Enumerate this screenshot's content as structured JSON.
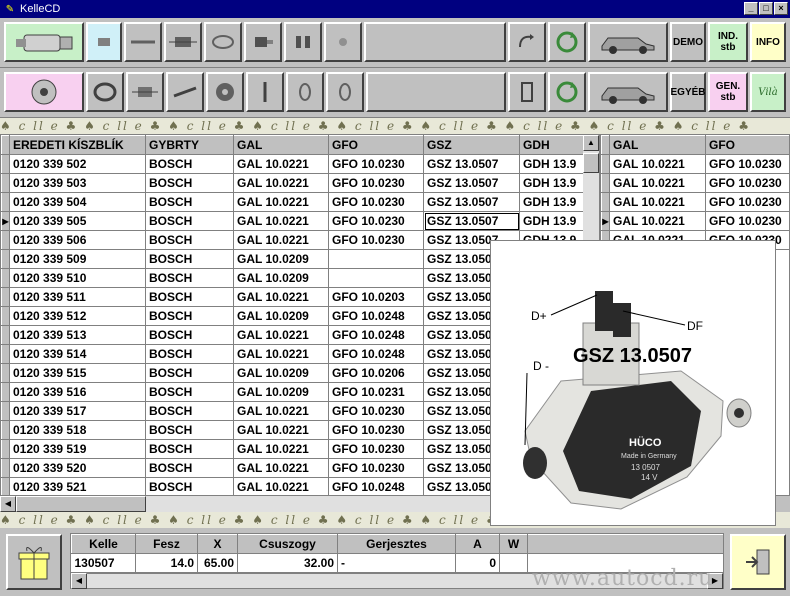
{
  "window": {
    "title": "KelleCD",
    "min": "_",
    "max": "□",
    "close": "×"
  },
  "toolbar1": {
    "demo": "DEMO",
    "ind": "IND.\nstb",
    "info": "INFO"
  },
  "toolbar2": {
    "egyeb": "EGYÉB",
    "gen": "GEN.\nstb",
    "brand": "Vilà"
  },
  "strip_text": "♠ c ll e ♣ ♠ c ll e ♣ ♠ c ll e ♣ ♠ c ll e ♣ ♠ c ll e ♣ ♠ c ll e ♣ ♠ c ll e ♣ ♠ c ll e ♣ ♠ c ll e ♣",
  "main_table": {
    "columns": [
      "EREDETI KÍSZBLÍK",
      "GYBRTY",
      "GAL",
      "GFO",
      "GSZ",
      "GDH"
    ],
    "rows": [
      [
        "0120 339 502",
        "BOSCH",
        "GAL 10.0221",
        "GFO 10.0230",
        "GSZ 13.0507",
        "GDH 13.9"
      ],
      [
        "0120 339 503",
        "BOSCH",
        "GAL 10.0221",
        "GFO 10.0230",
        "GSZ 13.0507",
        "GDH 13.9"
      ],
      [
        "0120 339 504",
        "BOSCH",
        "GAL 10.0221",
        "GFO 10.0230",
        "GSZ 13.0507",
        "GDH 13.9"
      ],
      [
        "0120 339 505",
        "BOSCH",
        "GAL 10.0221",
        "GFO 10.0230",
        "GSZ 13.0507",
        "GDH 13.9"
      ],
      [
        "0120 339 506",
        "BOSCH",
        "GAL 10.0221",
        "GFO 10.0230",
        "GSZ 13.0507",
        "GDH 13.9"
      ],
      [
        "0120 339 509",
        "BOSCH",
        "GAL 10.0209",
        "",
        "GSZ 13.050",
        ""
      ],
      [
        "0120 339 510",
        "BOSCH",
        "GAL 10.0209",
        "",
        "GSZ 13.050",
        ""
      ],
      [
        "0120 339 511",
        "BOSCH",
        "GAL 10.0221",
        "GFO 10.0203",
        "GSZ 13.050",
        ""
      ],
      [
        "0120 339 512",
        "BOSCH",
        "GAL 10.0209",
        "GFO 10.0248",
        "GSZ 13.050",
        ""
      ],
      [
        "0120 339 513",
        "BOSCH",
        "GAL 10.0221",
        "GFO 10.0248",
        "GSZ 13.050",
        ""
      ],
      [
        "0120 339 514",
        "BOSCH",
        "GAL 10.0221",
        "GFO 10.0248",
        "GSZ 13.050",
        ""
      ],
      [
        "0120 339 515",
        "BOSCH",
        "GAL 10.0209",
        "GFO 10.0206",
        "GSZ 13.050",
        ""
      ],
      [
        "0120 339 516",
        "BOSCH",
        "GAL 10.0209",
        "GFO 10.0231",
        "GSZ 13.050",
        ""
      ],
      [
        "0120 339 517",
        "BOSCH",
        "GAL 10.0221",
        "GFO 10.0230",
        "GSZ 13.050",
        ""
      ],
      [
        "0120 339 518",
        "BOSCH",
        "GAL 10.0221",
        "GFO 10.0230",
        "GSZ 13.050",
        ""
      ],
      [
        "0120 339 519",
        "BOSCH",
        "GAL 10.0221",
        "GFO 10.0230",
        "GSZ 13.050",
        ""
      ],
      [
        "0120 339 520",
        "BOSCH",
        "GAL 10.0221",
        "GFO 10.0230",
        "GSZ 13.050",
        ""
      ],
      [
        "0120 339 521",
        "BOSCH",
        "GAL 10.0221",
        "GFO 10.0248",
        "GSZ 13.050",
        ""
      ]
    ],
    "current_row_marker": "▶"
  },
  "side_table": {
    "columns": [
      "GAL",
      "GFO"
    ],
    "rows": [
      [
        "GAL 10.0221",
        "GFO 10.0230"
      ],
      [
        "GAL 10.0221",
        "GFO 10.0230"
      ],
      [
        "GAL 10.0221",
        "GFO 10.0230"
      ],
      [
        "GAL 10.0221",
        "GFO 10.0230"
      ],
      [
        "GAL 10.0221",
        "GFO 10.0230"
      ]
    ]
  },
  "popup": {
    "caption": "GSZ 13.0507",
    "label_dplus": "D+",
    "label_df": "DF",
    "label_dminus": "D -",
    "part_brand": "HÜCO",
    "part_made": "Made in Germany",
    "part_number": "13 0507",
    "part_voltage": "14 V"
  },
  "bottom_table": {
    "columns": [
      "Kelle",
      "Fesz",
      "X",
      "Csuszogy",
      "Gerjesztes",
      "A",
      "W"
    ],
    "row": [
      "130507",
      "14.0",
      "65.00",
      "32.00",
      "-",
      "0",
      ""
    ]
  },
  "watermark": "www.autocd.ru"
}
